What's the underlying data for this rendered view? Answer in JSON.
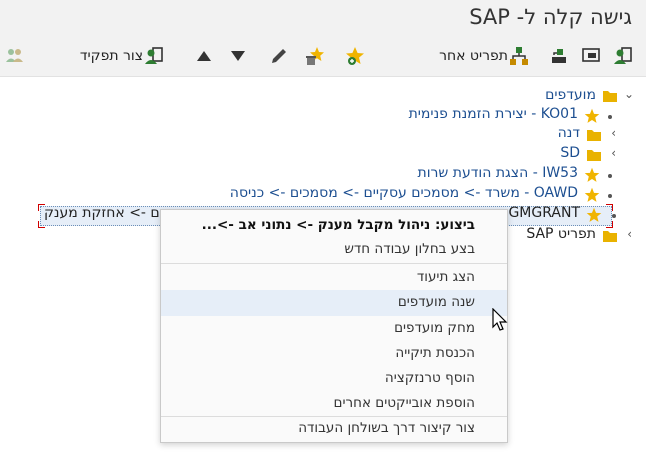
{
  "window": {
    "title": "גישה קלה ל- SAP"
  },
  "toolbar": {
    "role_label": "צור תפקיד",
    "other_menu_label": "תפריט אחר",
    "icons": [
      "user-role-icon",
      "user-menu-icon",
      "sap-menu-icon",
      "download-icon",
      "hierarchy-icon",
      "add-favorite-icon",
      "delete-favorite-icon",
      "pencil-icon",
      "triangle-down-icon",
      "triangle-up-icon",
      "create-role-icon",
      "users-icon"
    ]
  },
  "tree": {
    "favorites_label": "מועדפים",
    "items": [
      {
        "code": "KO01",
        "text": "יצירת הזמנת פנימית",
        "type": "transaction"
      },
      {
        "text": "דנה",
        "type": "folder"
      },
      {
        "text": "SD",
        "type": "folder"
      },
      {
        "code": "IW53",
        "text": "הצגת הודעת שרות",
        "type": "transaction"
      },
      {
        "code": "OAWD",
        "text": "משרד -> מסמכים עסקיים -> מסמכים -> כניסה",
        "type": "transaction"
      },
      {
        "code": "GMGRANT",
        "text_visible": "ים -> אחזקת מענק",
        "type": "transaction"
      }
    ],
    "sap_menu_label": "תפריט SAP"
  },
  "context_menu": {
    "items": [
      {
        "label": "ביצוע: ניהול מקבל מענק -> נתוני אב ->...",
        "bold": true
      },
      {
        "label": "בצע בחלון עבודה חדש"
      },
      {
        "label": "הצג תיעוד"
      },
      {
        "label": "שנה מועדפים",
        "hover": true
      },
      {
        "label": "מחק מועדפים"
      },
      {
        "label": "הכנסת תיקייה"
      },
      {
        "label": "הוסף טרנזקציה"
      },
      {
        "label": "הוספת אובייקטים אחרים"
      },
      {
        "label": "צור קיצור דרך בשולחן העבודה"
      }
    ]
  },
  "colors": {
    "link_blue": "#1d4f91",
    "star_gold": "#f0b400",
    "folder_gold": "#e9b200",
    "icon_green": "#2e7d32"
  }
}
